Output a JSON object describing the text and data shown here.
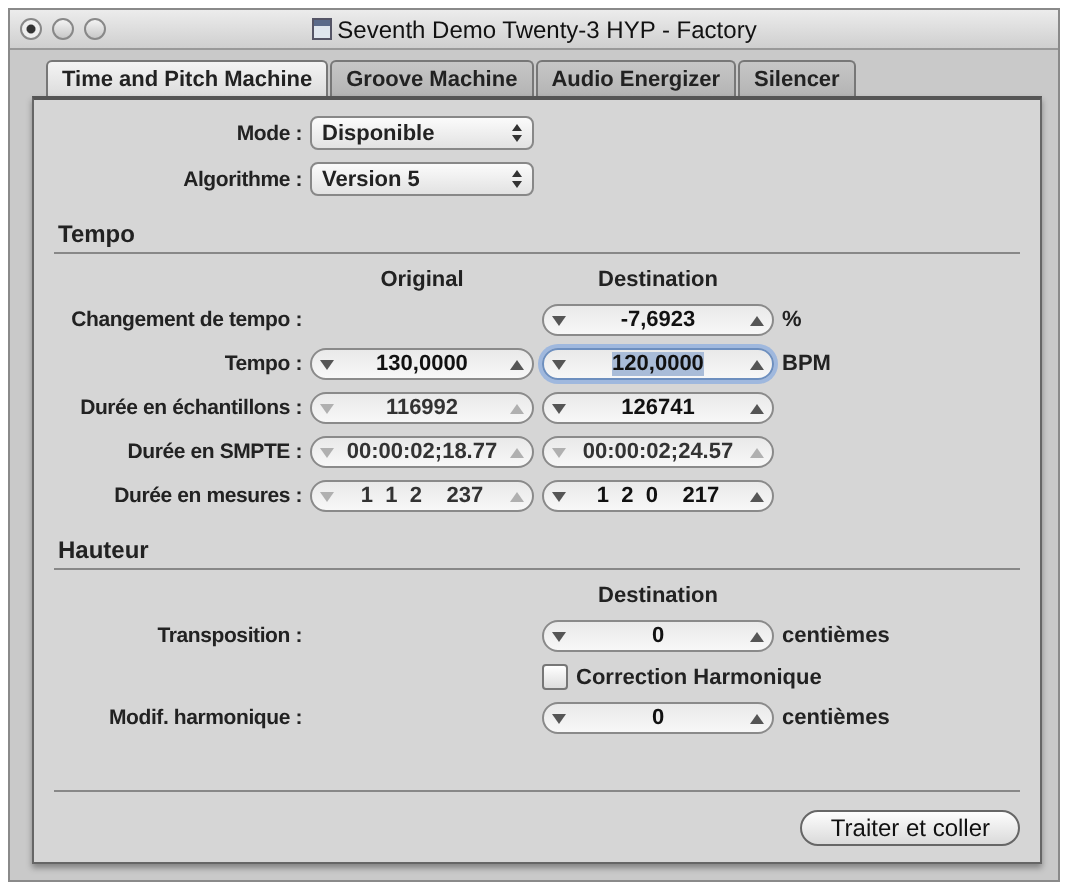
{
  "window": {
    "title": "Seventh Demo Twenty-3 HYP - Factory"
  },
  "tabs": [
    {
      "label": "Time and Pitch Machine",
      "selected": true
    },
    {
      "label": "Groove Machine",
      "selected": false
    },
    {
      "label": "Audio Energizer",
      "selected": false
    },
    {
      "label": "Silencer",
      "selected": false
    }
  ],
  "selects": [
    {
      "label": "Mode :",
      "value": "Disponible"
    },
    {
      "label": "Algorithme :",
      "value": "Version 5"
    }
  ],
  "tempo": {
    "title": "Tempo",
    "columns": [
      "Original",
      "Destination"
    ],
    "rows": [
      {
        "label": "Changement de tempo :",
        "destination": {
          "value": "-7,6923",
          "disabled": false,
          "focused": false
        },
        "unit": "%"
      },
      {
        "label": "Tempo :",
        "original": {
          "value": "130,0000",
          "disabled": false,
          "focused": false
        },
        "destination": {
          "value": "120,0000",
          "disabled": false,
          "focused": true
        },
        "unit": "BPM"
      },
      {
        "label": "Durée en échantillons :",
        "original": {
          "value": "116992",
          "disabled": true,
          "focused": false
        },
        "destination": {
          "value": "126741",
          "disabled": false,
          "focused": false
        }
      },
      {
        "label": "Durée en SMPTE :",
        "original": {
          "value": "00:00:02;18.77",
          "disabled": true,
          "focused": false
        },
        "destination": {
          "value": "00:00:02;24.57",
          "disabled": true,
          "focused": false
        }
      },
      {
        "label": "Durée en mesures :",
        "original": {
          "value": "1  1  2    237",
          "disabled": true,
          "focused": false
        },
        "destination": {
          "value": "1  2  0    217",
          "disabled": false,
          "focused": false
        }
      }
    ]
  },
  "pitch": {
    "title": "Hauteur",
    "column": "Destination",
    "rows": [
      {
        "kind": "spinner",
        "label": "Transposition :",
        "value": "0",
        "unit": "centièmes"
      },
      {
        "kind": "checkbox",
        "label": "Correction Harmonique",
        "checked": false
      },
      {
        "kind": "spinner",
        "label": "Modif. harmonique :",
        "value": "0",
        "unit": "centièmes"
      }
    ]
  },
  "button": "Traiter et coller"
}
